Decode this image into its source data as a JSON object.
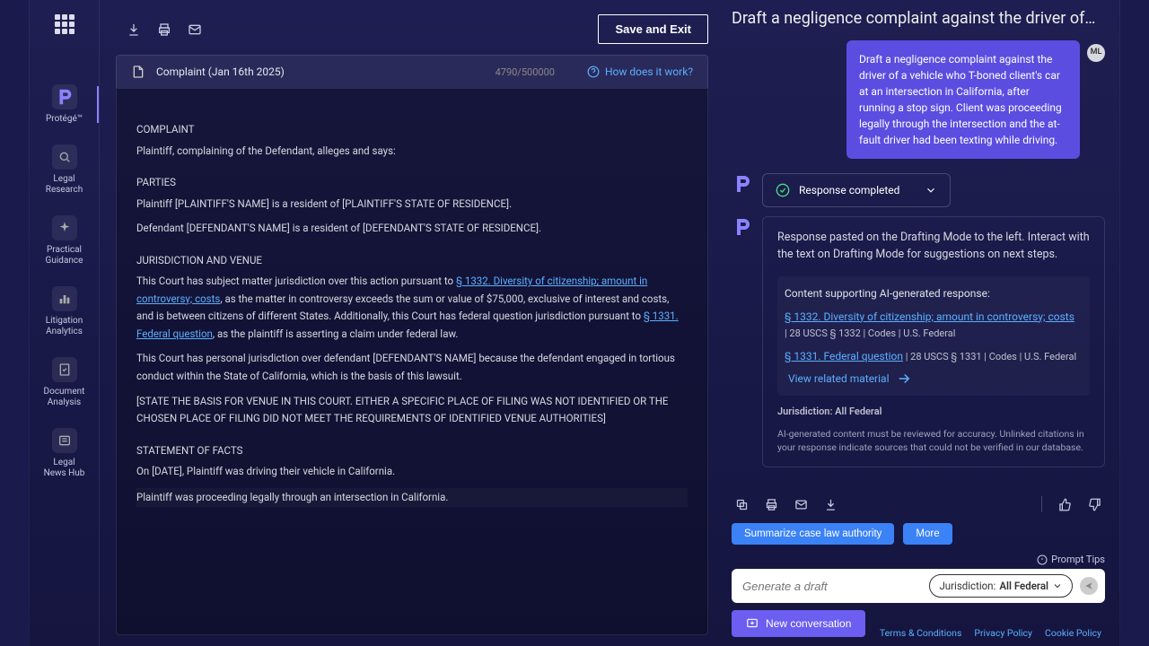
{
  "sidebar": {
    "items": [
      {
        "label": "Protégé™"
      },
      {
        "label": "Legal\nResearch"
      },
      {
        "label": "Practical\nGuidance"
      },
      {
        "label": "Litigation\nAnalytics"
      },
      {
        "label": "Document\nAnalysis"
      },
      {
        "label": "Legal\nNews Hub"
      }
    ]
  },
  "toolbar": {
    "save_exit": "Save and Exit"
  },
  "doc": {
    "title": "Complaint (Jan 16th 2025)",
    "char_count": "4790/500000",
    "how_link": "How does it work?"
  },
  "editor": {
    "h1": "COMPLAINT",
    "intro": "Plaintiff, complaining of the Defendant, alleges and says:",
    "parties_h": "PARTIES",
    "parties_1": "Plaintiff [PLAINTIFF'S NAME] is a resident of [PLAINTIFF'S STATE OF RESIDENCE].",
    "parties_2": "Defendant [DEFENDANT'S NAME] is a resident of [DEFENDANT'S STATE OF RESIDENCE].",
    "juris_h": "JURISDICTION AND VENUE",
    "juris_1a": "This Court has subject matter jurisdiction over this action pursuant to ",
    "juris_link1": "§ 1332. Diversity of citizenship; amount in controversy; costs",
    "juris_1b": ", as the matter in controversy exceeds the sum or value of $75,000, exclusive of interest and costs, and is between citizens of different States. Additionally, this Court has federal question jurisdiction pursuant to ",
    "juris_link2": "§ 1331. Federal question",
    "juris_1c": ", as the plaintiff is asserting a claim under federal law.",
    "juris_2": "This Court has personal jurisdiction over defendant [DEFENDANT'S NAME] because the defendant engaged in tortious conduct within the State of California, which is the basis of this lawsuit.",
    "juris_3": "[STATE THE BASIS FOR VENUE IN THIS COURT. EITHER A SPECIFIC PLACE OF FILING WAS NOT IDENTIFIED OR THE CHOSEN PLACE OF FILING DID NOT MEET THE REQUIREMENTS OF IDENTIFIED VENUE AUTHORITIES]",
    "facts_h": "STATEMENT OF FACTS",
    "facts_1": "On [DATE], Plaintiff was driving their vehicle in California.",
    "facts_2": "Plaintiff was proceeding legally through an intersection in California."
  },
  "chat": {
    "title": "Draft a negligence complaint against the driver of…",
    "user_msg": "Draft a negligence complaint against the driver of a vehicle who T-boned client's car at an intersection in California, after running a stop sign. Client was proceeding legally through the intersection and the at-fault driver had been texting while driving.",
    "user_initials": "ML",
    "status": "Response completed",
    "response_msg": "Response pasted on the Drafting Mode to the left. Interact with the text on Drafting Mode for suggestions on next steps.",
    "support_title": "Content supporting AI-generated response:",
    "cite1_link": "§ 1332. Diversity of citizenship; amount in controversy; costs",
    "cite1_meta": "| 28 USCS § 1332 | Codes  | U.S. Federal",
    "cite2_link": "§ 1331. Federal question",
    "cite2_meta": " | 28 USCS § 1331 | Codes  | U.S. Federal",
    "view_related": "View related material",
    "juris_line": "Jurisdiction: All Federal",
    "disclaimer": "AI-generated content must be reviewed for accuracy. Unlinked citations in your response indicate sources that could not be verified in our database.",
    "chip_summarize": "Summarize case law authority",
    "chip_more": "More",
    "prompt_tips": "Prompt Tips",
    "input_placeholder": "Generate a draft",
    "juris_label": "Jurisdiction:",
    "juris_value": "All Federal",
    "new_convo": "New conversation"
  },
  "footer": {
    "terms": "Terms & Conditions",
    "privacy": "Privacy Policy",
    "cookie": "Cookie Policy"
  }
}
